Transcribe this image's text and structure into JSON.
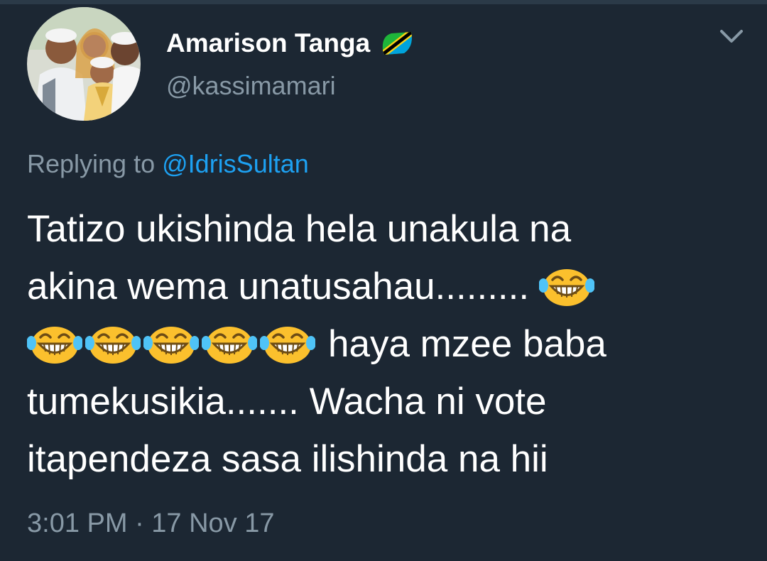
{
  "author": {
    "display_name": "Amarison Tanga",
    "handle": "@kassimamari",
    "flag_icon": "tanzania-flag-icon",
    "avatar_icon": "family-photo-avatar"
  },
  "menu": {
    "icon": "chevron-down-icon"
  },
  "reply": {
    "prefix": "Replying to",
    "target": "@IdrisSultan"
  },
  "tweet": {
    "line1": "Tatizo ukishinda hela unakula na",
    "line2": "akina wema unatusahau.........",
    "line3_text": "haya mzee baba",
    "line4": "tumekusikia....... Wacha ni vote",
    "line5": "itapendeza sasa ilishinda na hii",
    "emoji_icon": "face-with-tears-of-joy-icon"
  },
  "timestamp": "3:01 PM · 17 Nov 17",
  "colors": {
    "background": "#1c2733",
    "secondary_text": "#8899a6",
    "link": "#1da1f2",
    "primary_text": "#ffffff"
  }
}
